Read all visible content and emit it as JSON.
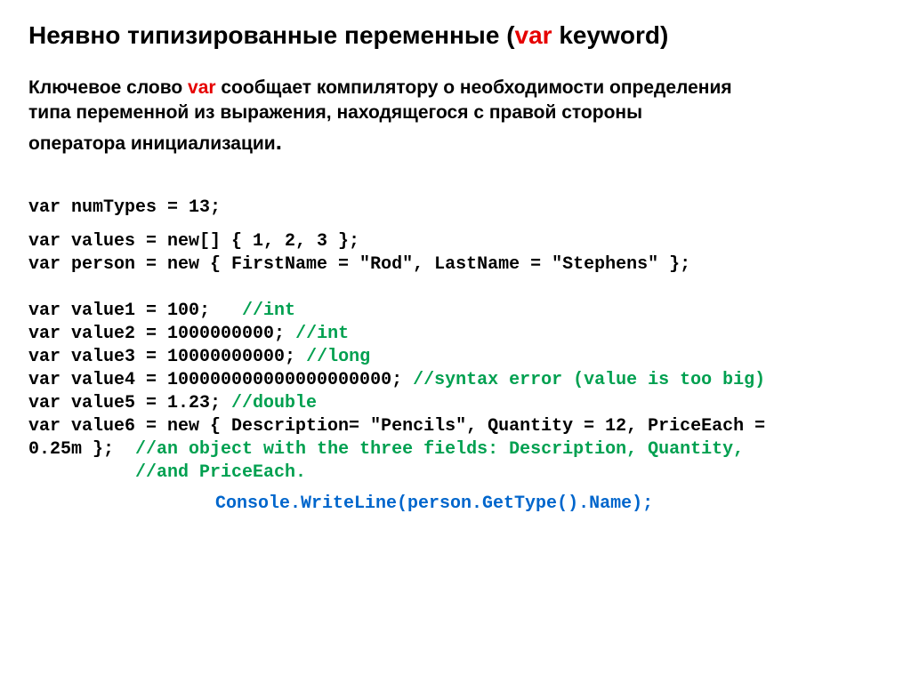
{
  "title": {
    "pre": "Неявно типизированные переменные (",
    "var": "var",
    "post": " keyword)"
  },
  "desc": {
    "l1a": "Ключевое слово ",
    "l1var": "var",
    "l1b": " сообщает компилятору о необходимости определения",
    "l2": "типа переменной из выражения, находящегося с правой стороны",
    "l3": "оператора инициализации",
    "period": "."
  },
  "code": {
    "c1": "var numTypes = 13;",
    "c2": "var values = new[] { 1, 2, 3 };",
    "c3": "var person = new { FirstName = \"Rod\", LastName = \"Stephens\" };",
    "c4a": "var value1 = 100;   ",
    "c4b": "//int",
    "c5a": "var value2 = 1000000000; ",
    "c5b": "//int",
    "c6a": "var value3 = 10000000000; ",
    "c6b": "//long",
    "c7a": "var value4 = 100000000000000000000; ",
    "c7b": "//syntax error (value is too big)",
    "c8a": "var value5 = 1.23; ",
    "c8b": "//double",
    "c9": "var value6 = new { Description= \"Pencils\", Quantity = 12, PriceEach =",
    "c10a": "0.25m };  ",
    "c10b": "//an object with the three fields: Description, Quantity,",
    "c11": "          //and PriceEach."
  },
  "console": "Console.WriteLine(person.GetType().Name);"
}
